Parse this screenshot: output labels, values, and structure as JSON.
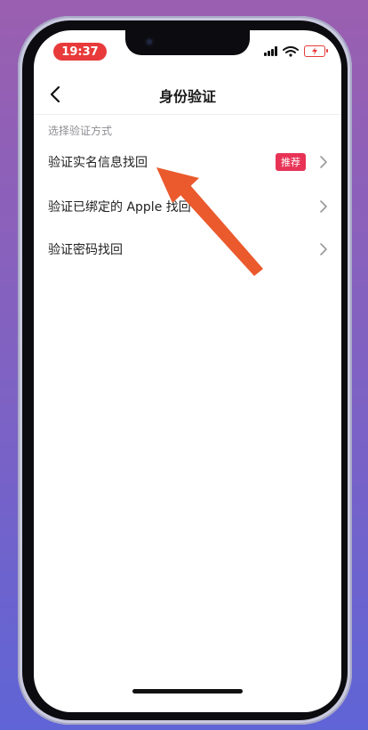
{
  "status_bar": {
    "time": "19:37"
  },
  "nav": {
    "title": "身份验证"
  },
  "section_label": "选择验证方式",
  "options": [
    {
      "label": "验证实名信息找回",
      "badge": "推荐"
    },
    {
      "label": "验证已绑定的 Apple 找回"
    },
    {
      "label": "验证密码找回"
    }
  ],
  "colors": {
    "accent_red": "#e83a3a",
    "badge_red": "#e83356",
    "annotation_arrow": "#ea5a2d"
  },
  "icons": {
    "back": "chevron-left-icon",
    "row_chevron": "chevron-right-icon",
    "signal": "cellular-signal-icon",
    "wifi": "wifi-icon",
    "battery": "battery-charging-icon"
  }
}
